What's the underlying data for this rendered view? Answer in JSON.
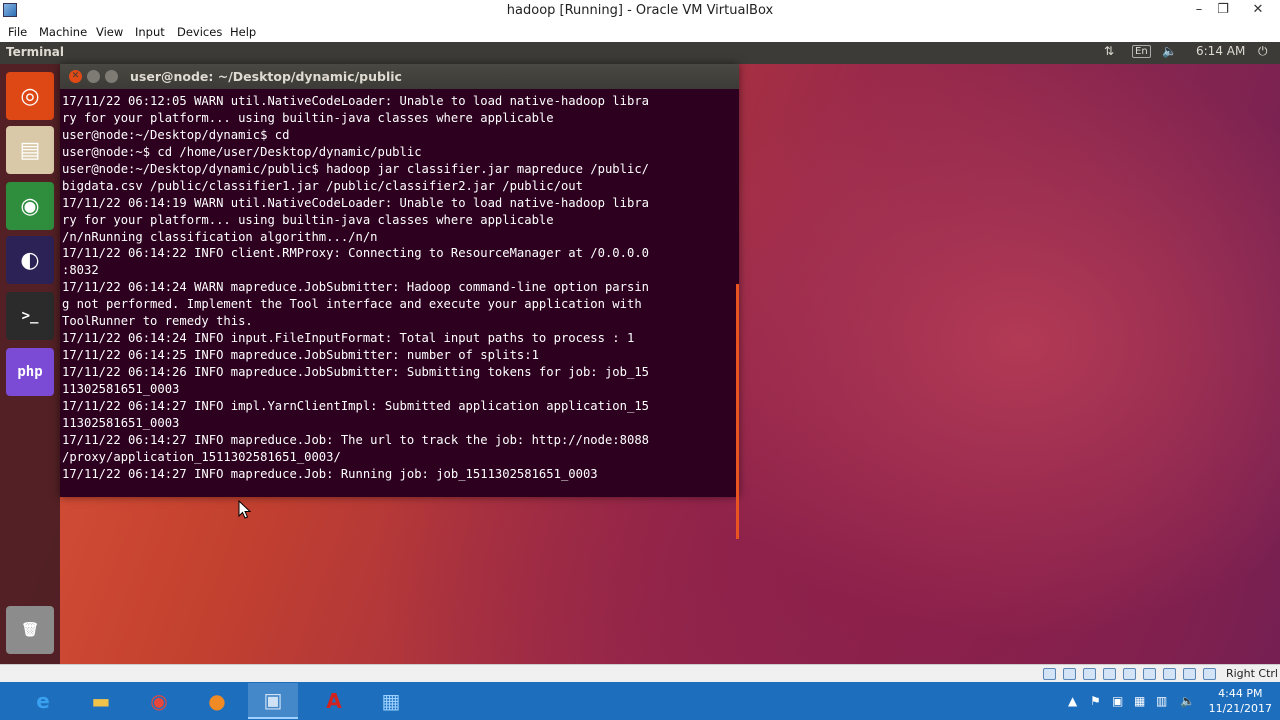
{
  "host": {
    "title": "hadoop [Running] - Oracle VM VirtualBox",
    "menu": [
      "File",
      "Machine",
      "View",
      "Input",
      "Devices",
      "Help"
    ],
    "host_key": "Right Ctrl"
  },
  "guest": {
    "panel_title": "Terminal",
    "language": "En",
    "time": "6:14 AM",
    "launcher": [
      {
        "name": "ubuntu-dash",
        "glyph": "◎",
        "color": "#dd4814"
      },
      {
        "name": "files",
        "glyph": "▤",
        "color": "#d9c9a8"
      },
      {
        "name": "chrome",
        "glyph": "◉",
        "color": "#2f8e3d"
      },
      {
        "name": "eclipse",
        "glyph": "◐",
        "color": "#2c2255"
      },
      {
        "name": "terminal",
        "glyph": ">_",
        "color": "#2b2b2b"
      },
      {
        "name": "phpstorm",
        "glyph": "php",
        "color": "#7b4bd6"
      },
      {
        "name": "trash",
        "glyph": "🗑",
        "color": "#8c8c8c"
      }
    ]
  },
  "terminal": {
    "title": "user@node: ~/Desktop/dynamic/public",
    "lines": [
      "17/11/22 06:12:05 WARN util.NativeCodeLoader: Unable to load native-hadoop libra",
      "ry for your platform... using builtin-java classes where applicable",
      "user@node:~/Desktop/dynamic$ cd",
      "user@node:~$ cd /home/user/Desktop/dynamic/public",
      "user@node:~/Desktop/dynamic/public$ hadoop jar classifier.jar mapreduce /public/",
      "bigdata.csv /public/classifier1.jar /public/classifier2.jar /public/out",
      "17/11/22 06:14:19 WARN util.NativeCodeLoader: Unable to load native-hadoop libra",
      "ry for your platform... using builtin-java classes where applicable",
      "/n/nRunning classification algorithm.../n/n",
      "17/11/22 06:14:22 INFO client.RMProxy: Connecting to ResourceManager at /0.0.0.0",
      ":8032",
      "17/11/22 06:14:24 WARN mapreduce.JobSubmitter: Hadoop command-line option parsin",
      "g not performed. Implement the Tool interface and execute your application with",
      "ToolRunner to remedy this.",
      "17/11/22 06:14:24 INFO input.FileInputFormat: Total input paths to process : 1",
      "17/11/22 06:14:25 INFO mapreduce.JobSubmitter: number of splits:1",
      "17/11/22 06:14:26 INFO mapreduce.JobSubmitter: Submitting tokens for job: job_15",
      "11302581651_0003",
      "17/11/22 06:14:27 INFO impl.YarnClientImpl: Submitted application application_15",
      "11302581651_0003",
      "17/11/22 06:14:27 INFO mapreduce.Job: The url to track the job: http://node:8088",
      "/proxy/application_1511302581651_0003/",
      "17/11/22 06:14:27 INFO mapreduce.Job: Running job: job_1511302581651_0003"
    ]
  },
  "taskbar": {
    "apps": [
      {
        "name": "internet-explorer",
        "glyph": "e",
        "color": "#3aa0f0",
        "active": false
      },
      {
        "name": "file-explorer",
        "glyph": "▬",
        "color": "#f2c34a",
        "active": false
      },
      {
        "name": "chrome",
        "glyph": "◉",
        "color": "#e8483b",
        "active": false
      },
      {
        "name": "firefox",
        "glyph": "●",
        "color": "#f08a24",
        "active": false
      },
      {
        "name": "virtualbox",
        "glyph": "▣",
        "color": "#cfe2f5",
        "active": true
      },
      {
        "name": "acrobat",
        "glyph": "A",
        "color": "#d3231e",
        "active": false
      },
      {
        "name": "remote-app",
        "glyph": "▦",
        "color": "#9ad0ff",
        "active": false
      }
    ],
    "time": "4:44 PM",
    "date": "11/21/2017"
  }
}
